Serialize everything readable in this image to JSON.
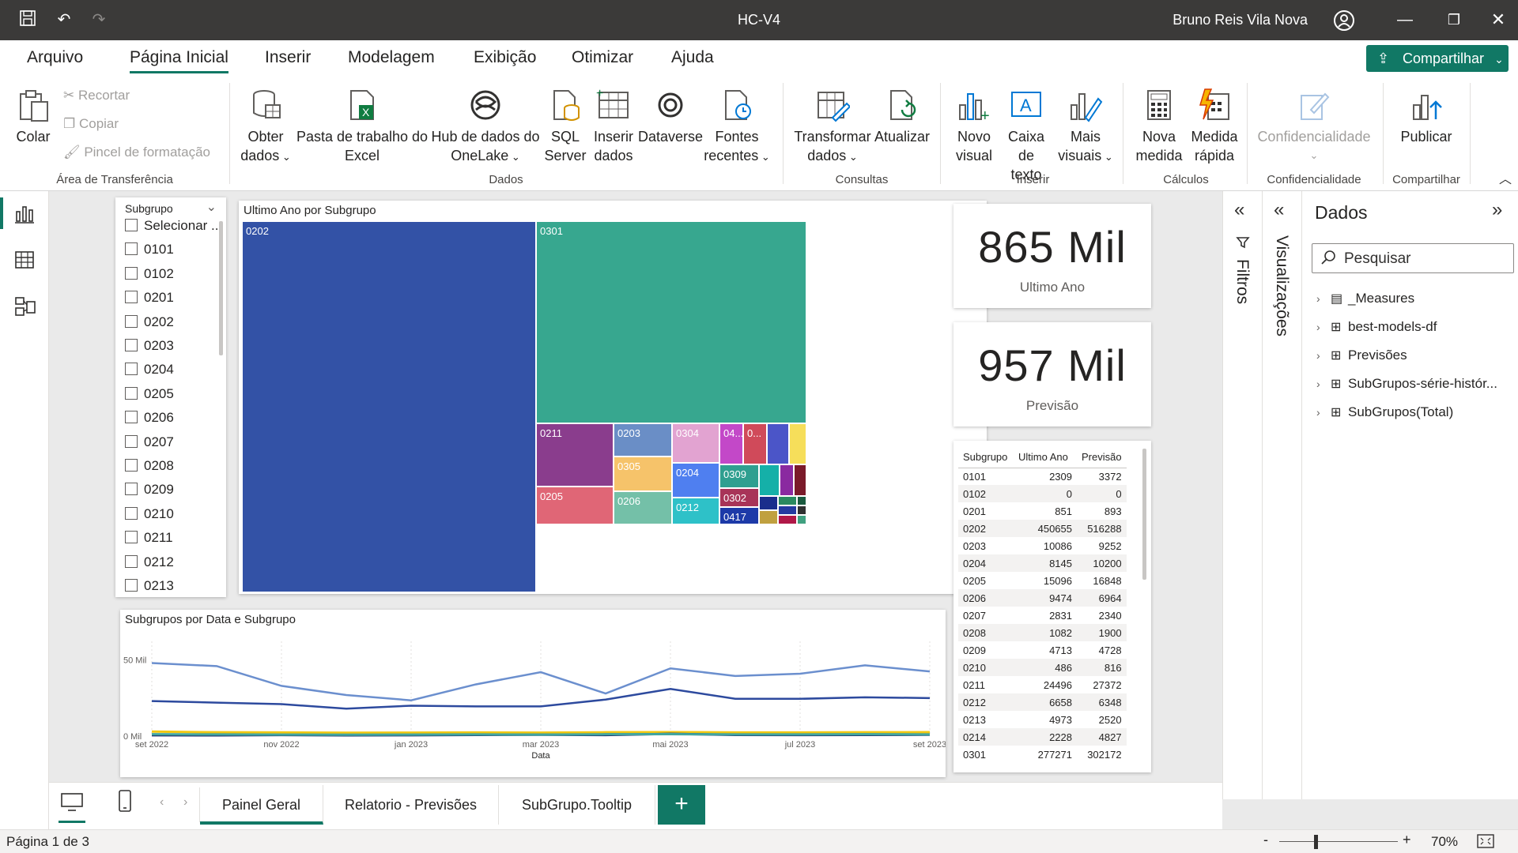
{
  "window": {
    "title": "HC-V4",
    "user": "Bruno Reis Vila Nova"
  },
  "ribbon_tabs": [
    "Arquivo",
    "Página Inicial",
    "Inserir",
    "Modelagem",
    "Exibição",
    "Otimizar",
    "Ajuda"
  ],
  "share_label": "Compartilhar",
  "ribbon": {
    "clipboard": {
      "paste": "Colar",
      "cut": "Recortar",
      "copy": "Copiar",
      "format_painter": "Pincel de formatação",
      "group": "Área de Transferência"
    },
    "data": {
      "get_data_1": "Obter",
      "get_data_2": "dados",
      "excel_1": "Pasta de trabalho do",
      "excel_2": "Excel",
      "onelake_1": "Hub de dados do",
      "onelake_2": "OneLake",
      "sql_1": "SQL",
      "sql_2": "Server",
      "enter_1": "Inserir",
      "enter_2": "dados",
      "dataverse": "Dataverse",
      "recent_1": "Fontes",
      "recent_2": "recentes",
      "group": "Dados"
    },
    "queries": {
      "transform_1": "Transformar",
      "transform_2": "dados",
      "refresh": "Atualizar",
      "group": "Consultas"
    },
    "insert": {
      "new_visual_1": "Novo",
      "new_visual_2": "visual",
      "textbox_1": "Caixa de",
      "textbox_2": "texto",
      "more_1": "Mais",
      "more_2": "visuais",
      "group": "Inserir"
    },
    "calc": {
      "new_measure_1": "Nova",
      "new_measure_2": "medida",
      "quick_measure_1": "Medida",
      "quick_measure_2": "rápida",
      "group": "Cálculos"
    },
    "sensitivity": {
      "label": "Confidencialidade",
      "group": "Confidencialidade"
    },
    "share": {
      "publish": "Publicar",
      "group": "Compartilhar"
    }
  },
  "slicer": {
    "title": "Subgrupo",
    "items": [
      "Selecionar ...",
      "0101",
      "0102",
      "0201",
      "0202",
      "0203",
      "0204",
      "0205",
      "0206",
      "0207",
      "0208",
      "0209",
      "0210",
      "0211",
      "0212",
      "0213"
    ]
  },
  "treemap": {
    "title": "Ultimo Ano por Subgrupo",
    "labels": {
      "t0202": "0202",
      "t0301": "0301",
      "t0211": "0211",
      "t0203": "0203",
      "t0304": "0304",
      "t04": "04...",
      "t0dots": "0...",
      "t0305": "0305",
      "t0204": "0204",
      "t0309": "0309",
      "t0205": "0205",
      "t0206": "0206",
      "t0212": "0212",
      "t0302": "0302",
      "t0417": "0417"
    }
  },
  "kpi1": {
    "value": "865 Mil",
    "label": "Ultimo Ano"
  },
  "kpi2": {
    "value": "957 Mil",
    "label": "Previsão"
  },
  "table": {
    "headers": [
      "Subgrupo",
      "Ultimo Ano",
      "Previsão"
    ],
    "rows": [
      [
        "0101",
        "2309",
        "3372"
      ],
      [
        "0102",
        "0",
        "0"
      ],
      [
        "0201",
        "851",
        "893"
      ],
      [
        "0202",
        "450655",
        "516288"
      ],
      [
        "0203",
        "10086",
        "9252"
      ],
      [
        "0204",
        "8145",
        "10200"
      ],
      [
        "0205",
        "15096",
        "16848"
      ],
      [
        "0206",
        "9474",
        "6964"
      ],
      [
        "0207",
        "2831",
        "2340"
      ],
      [
        "0208",
        "1082",
        "1900"
      ],
      [
        "0209",
        "4713",
        "4728"
      ],
      [
        "0210",
        "486",
        "816"
      ],
      [
        "0211",
        "24496",
        "27372"
      ],
      [
        "0212",
        "6658",
        "6348"
      ],
      [
        "0213",
        "4973",
        "2520"
      ],
      [
        "0214",
        "2228",
        "4827"
      ],
      [
        "0301",
        "277271",
        "302172"
      ]
    ]
  },
  "chart_data": {
    "type": "line",
    "title": "Subgrupos por Data e Subgrupo",
    "xlabel": "Data",
    "ylabel": "",
    "x_tick_labels": [
      "set 2022",
      "nov 2022",
      "jan 2023",
      "mar 2023",
      "mai 2023",
      "jul 2023",
      "set 2023"
    ],
    "y_tick_labels": [
      "50 Mil",
      "0 Mil"
    ],
    "ylim": [
      0,
      55000
    ],
    "x": [
      0,
      1,
      2,
      3,
      4,
      5,
      6,
      7,
      8,
      9,
      10,
      11,
      12
    ],
    "series": [
      {
        "color": "#6b8fce",
        "values": [
          48000,
          46000,
          33000,
          27000,
          23500,
          34000,
          42000,
          28000,
          44500,
          39500,
          41000,
          46500,
          42500
        ]
      },
      {
        "color": "#2d4a9e",
        "values": [
          23000,
          22000,
          21000,
          18000,
          20000,
          19500,
          19500,
          24000,
          31000,
          24500,
          24500,
          25500,
          25000
        ]
      },
      {
        "color": "#f2c811",
        "values": [
          3000,
          2500,
          2400,
          2200,
          2300,
          2400,
          2300,
          2500,
          2600,
          2400,
          2400,
          2500,
          2600
        ]
      },
      {
        "color": "#1b2f6e",
        "values": [
          600,
          500,
          700,
          500,
          600,
          800,
          900,
          700,
          1500,
          800,
          700,
          800,
          900
        ]
      },
      {
        "color": "#41a5a0",
        "values": [
          1200,
          1100,
          1000,
          900,
          1000,
          1100,
          1000,
          1200,
          1300,
          1100,
          1100,
          1200,
          1100
        ]
      }
    ]
  },
  "right_panes": {
    "filters": "Filtros",
    "visualizations": "Visualizações",
    "data_title": "Dados",
    "search_placeholder": "Pesquisar",
    "items": [
      "_Measures",
      "best-models-df",
      "Previsões",
      "SubGrupos-série-histór...",
      "SubGrupos(Total)"
    ]
  },
  "pages": [
    "Painel Geral",
    "Relatorio - Previsões",
    "SubGrupo.Tooltip"
  ],
  "status": {
    "page": "Página 1 de 3",
    "zoom": "70%"
  },
  "colors": {
    "accent": "#117865",
    "treemap_0202": "#3352a6",
    "treemap_0301": "#37a78f"
  }
}
